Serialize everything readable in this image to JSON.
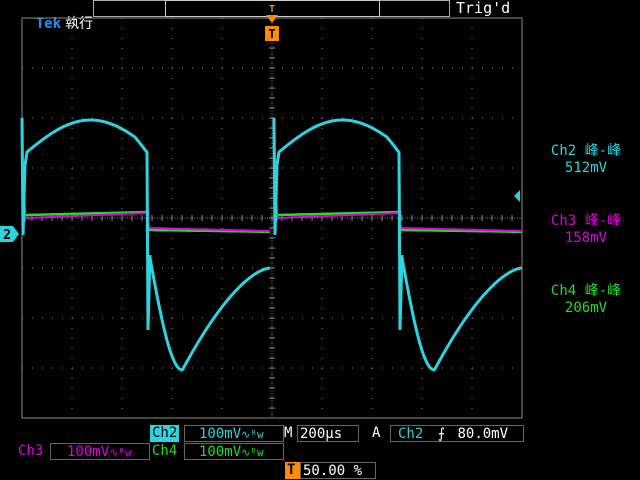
{
  "header": {
    "brand": "Tek",
    "run_state": "執行",
    "trigger_status": "Trig'd"
  },
  "measurements": [
    {
      "label": "Ch2 峰-峰",
      "value": "512mV",
      "color": "#2ed3e0"
    },
    {
      "label": "Ch3 峰-峰",
      "value": "158mV",
      "color": "#e100e1"
    },
    {
      "label": "Ch4 峰-峰",
      "value": "206mV",
      "color": "#22dd22"
    }
  ],
  "ch2_marker": "2",
  "trigger_marker": "T",
  "status": {
    "ch2_label": "Ch2",
    "ch2_scale": "100mV",
    "ch3_label": "Ch3",
    "ch3_scale": "100mV",
    "ch4_label": "Ch4",
    "ch4_scale": "100mV",
    "bw_symbol": "∿ᴮw",
    "timebase_label": "M",
    "timebase": "200µs",
    "trigger_mode": "A",
    "trigger_source": "Ch2",
    "trigger_slope": "⨍",
    "trigger_level": "80.0mV",
    "trigger_position_marker": "T",
    "trigger_position": "50.00 %"
  },
  "colors": {
    "ch2": "#2ed3e0",
    "ch3": "#e100e1",
    "ch4": "#22dd22",
    "grid": "#8a8a8a",
    "trigger": "#ff8c00"
  }
}
